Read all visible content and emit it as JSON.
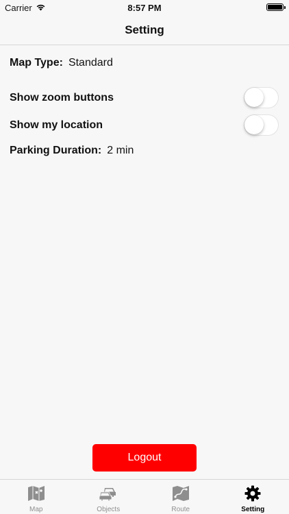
{
  "status": {
    "carrier": "Carrier",
    "time": "8:57 PM"
  },
  "nav": {
    "title": "Setting"
  },
  "settings": {
    "map_type_label": "Map Type:",
    "map_type_value": "Standard",
    "zoom_label": "Show zoom buttons",
    "zoom_on": false,
    "location_label": "Show my location",
    "location_on": false,
    "parking_label": "Parking Duration:",
    "parking_value": "2 min"
  },
  "logout_label": "Logout",
  "tabs": [
    {
      "label": "Map",
      "icon": "map-icon"
    },
    {
      "label": "Objects",
      "icon": "cars-icon"
    },
    {
      "label": "Route",
      "icon": "route-icon"
    },
    {
      "label": "Setting",
      "icon": "gear-icon",
      "active": true
    }
  ],
  "colors": {
    "accent": "#fe0000",
    "inactive_tab": "#8e8e8e",
    "background": "#f7f7f7"
  }
}
